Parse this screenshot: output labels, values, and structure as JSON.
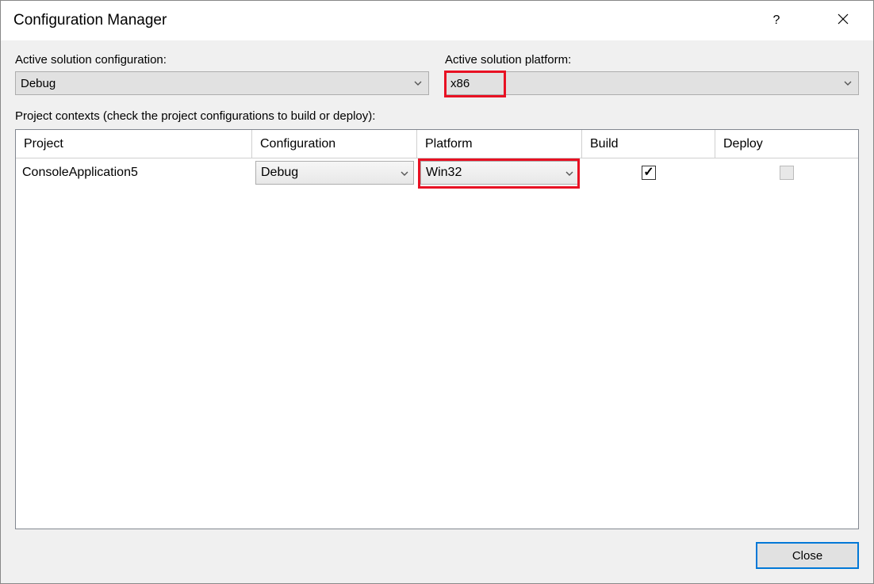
{
  "window": {
    "title": "Configuration Manager"
  },
  "top": {
    "config_label": "Active solution configuration:",
    "config_value": "Debug",
    "platform_label": "Active solution platform:",
    "platform_value": "x86"
  },
  "contexts_label": "Project contexts (check the project configurations to build or deploy):",
  "table": {
    "headers": {
      "project": "Project",
      "configuration": "Configuration",
      "platform": "Platform",
      "build": "Build",
      "deploy": "Deploy"
    },
    "rows": [
      {
        "project": "ConsoleApplication5",
        "configuration": "Debug",
        "platform": "Win32",
        "build_checked": true,
        "deploy_enabled": false
      }
    ]
  },
  "footer": {
    "close": "Close"
  },
  "checkmark": "✓"
}
